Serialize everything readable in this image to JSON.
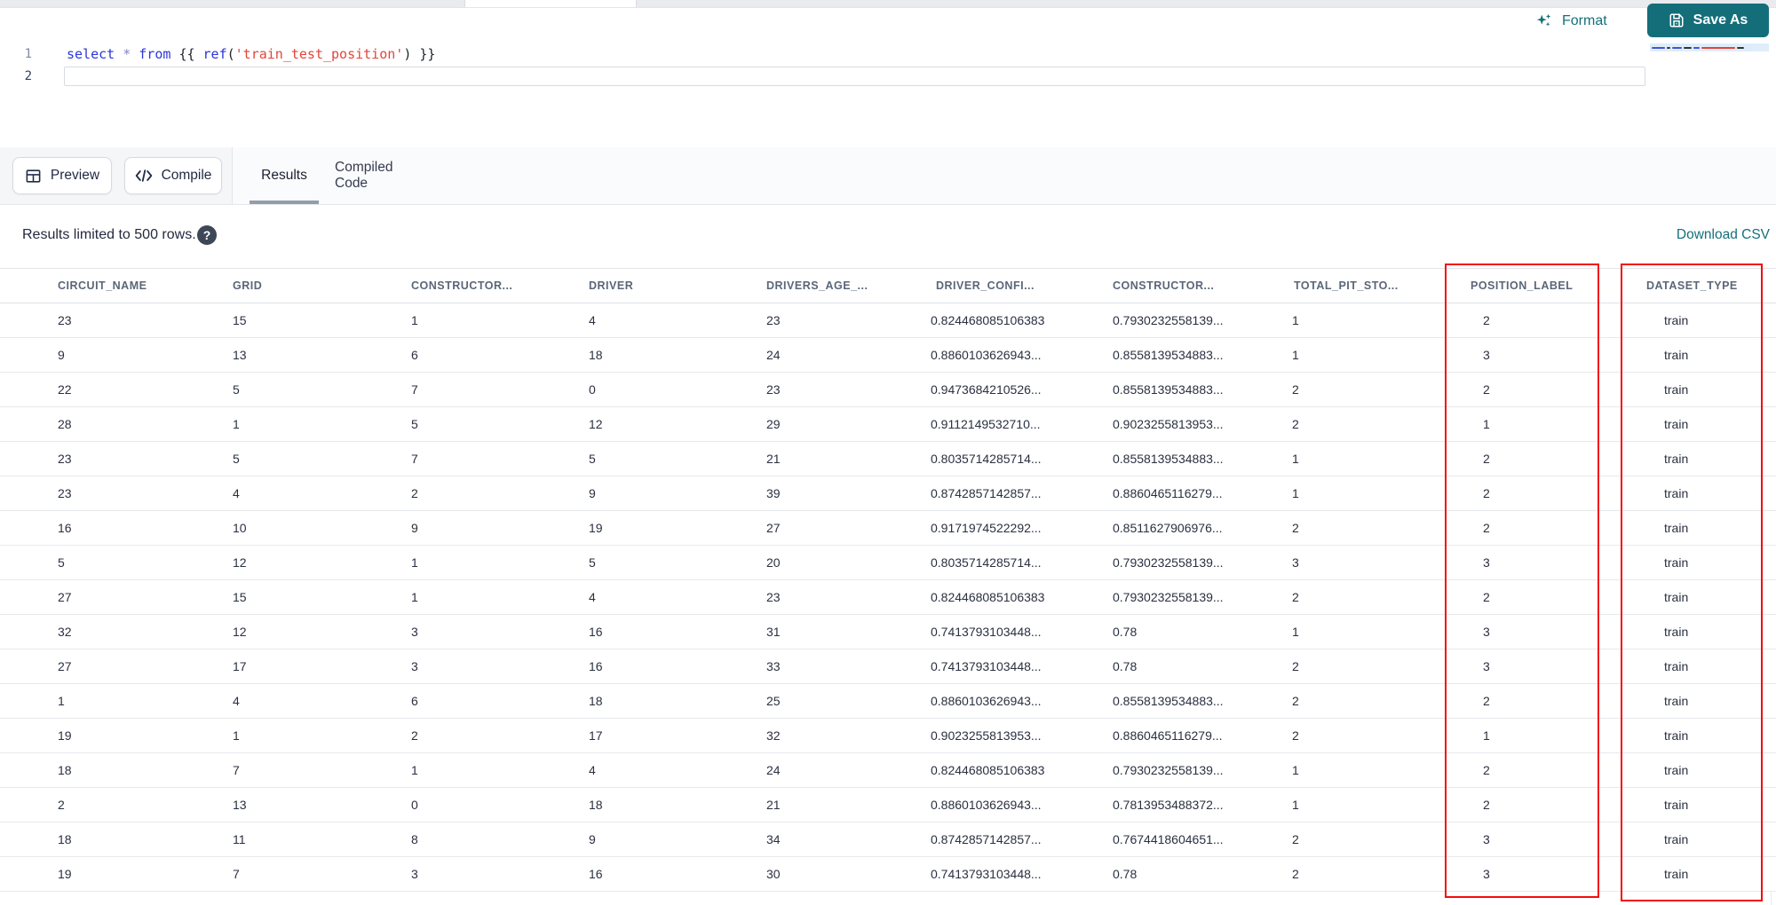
{
  "toolbar": {
    "format_label": "Format",
    "save_as_label": "Save As"
  },
  "editor": {
    "lines": [
      {
        "number": "1",
        "tokens": [
          {
            "type": "keyword",
            "text": "select"
          },
          {
            "type": "plain",
            "text": " "
          },
          {
            "type": "operator",
            "text": "*"
          },
          {
            "type": "plain",
            "text": " "
          },
          {
            "type": "keyword",
            "text": "from"
          },
          {
            "type": "plain",
            "text": " "
          },
          {
            "type": "brace",
            "text": "{{"
          },
          {
            "type": "plain",
            "text": " "
          },
          {
            "type": "function",
            "text": "ref"
          },
          {
            "type": "paren",
            "text": "("
          },
          {
            "type": "string",
            "text": "'train_test_position'"
          },
          {
            "type": "paren",
            "text": ")"
          },
          {
            "type": "plain",
            "text": " "
          },
          {
            "type": "brace",
            "text": "}}"
          }
        ]
      },
      {
        "number": "2",
        "tokens": []
      }
    ]
  },
  "actions": {
    "preview_label": "Preview",
    "compile_label": "Compile"
  },
  "tabs": [
    {
      "label": "Results",
      "active": true
    },
    {
      "label": "Compiled Code",
      "active": false
    }
  ],
  "results_bar": {
    "message": "Results limited to 500 rows.",
    "help_icon": "question-mark",
    "download_label": "Download CSV"
  },
  "table": {
    "columns": [
      "CIRCUIT_NAME",
      "GRID",
      "CONSTRUCTOR...",
      "DRIVER",
      "DRIVERS_AGE_...",
      "DRIVER_CONFI...",
      "CONSTRUCTOR...",
      "TOTAL_PIT_STO...",
      "POSITION_LABEL",
      "DATASET_TYPE"
    ],
    "rows": [
      [
        "23",
        "15",
        "1",
        "4",
        "23",
        "0.824468085106383",
        "0.7930232558139...",
        "1",
        "2",
        "train"
      ],
      [
        "9",
        "13",
        "6",
        "18",
        "24",
        "0.8860103626943...",
        "0.8558139534883...",
        "1",
        "3",
        "train"
      ],
      [
        "22",
        "5",
        "7",
        "0",
        "23",
        "0.9473684210526...",
        "0.8558139534883...",
        "2",
        "2",
        "train"
      ],
      [
        "28",
        "1",
        "5",
        "12",
        "29",
        "0.9112149532710...",
        "0.9023255813953...",
        "2",
        "1",
        "train"
      ],
      [
        "23",
        "5",
        "7",
        "5",
        "21",
        "0.8035714285714...",
        "0.8558139534883...",
        "1",
        "2",
        "train"
      ],
      [
        "23",
        "4",
        "2",
        "9",
        "39",
        "0.8742857142857...",
        "0.8860465116279...",
        "1",
        "2",
        "train"
      ],
      [
        "16",
        "10",
        "9",
        "19",
        "27",
        "0.9171974522292...",
        "0.8511627906976...",
        "2",
        "2",
        "train"
      ],
      [
        "5",
        "12",
        "1",
        "5",
        "20",
        "0.8035714285714...",
        "0.7930232558139...",
        "3",
        "3",
        "train"
      ],
      [
        "27",
        "15",
        "1",
        "4",
        "23",
        "0.824468085106383",
        "0.7930232558139...",
        "2",
        "2",
        "train"
      ],
      [
        "32",
        "12",
        "3",
        "16",
        "31",
        "0.7413793103448...",
        "0.78",
        "1",
        "3",
        "train"
      ],
      [
        "27",
        "17",
        "3",
        "16",
        "33",
        "0.7413793103448...",
        "0.78",
        "2",
        "3",
        "train"
      ],
      [
        "1",
        "4",
        "6",
        "18",
        "25",
        "0.8860103626943...",
        "0.8558139534883...",
        "2",
        "2",
        "train"
      ],
      [
        "19",
        "1",
        "2",
        "17",
        "32",
        "0.9023255813953...",
        "0.8860465116279...",
        "2",
        "1",
        "train"
      ],
      [
        "18",
        "7",
        "1",
        "4",
        "24",
        "0.824468085106383",
        "0.7930232558139...",
        "1",
        "2",
        "train"
      ],
      [
        "2",
        "13",
        "0",
        "18",
        "21",
        "0.8860103626943...",
        "0.7813953488372...",
        "1",
        "2",
        "train"
      ],
      [
        "18",
        "11",
        "8",
        "9",
        "34",
        "0.8742857142857...",
        "0.7674418604651...",
        "2",
        "3",
        "train"
      ],
      [
        "19",
        "7",
        "3",
        "16",
        "30",
        "0.7413793103448...",
        "0.78",
        "2",
        "3",
        "train"
      ]
    ],
    "highlighted_columns": [
      "POSITION_LABEL",
      "DATASET_TYPE"
    ]
  },
  "colors": {
    "accent_teal": "#146e7a",
    "highlight_red": "#f20d0d",
    "keyword_blue": "#2b35d8",
    "string_red": "#e2453a"
  }
}
